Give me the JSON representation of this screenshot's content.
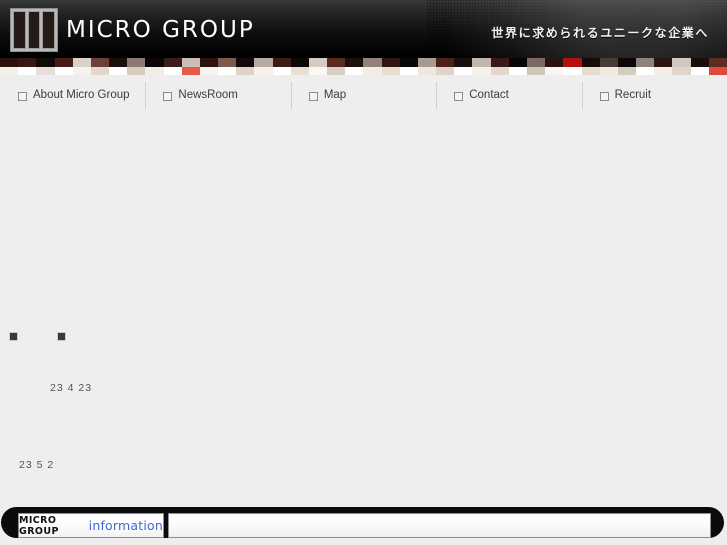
{
  "header": {
    "brand": "MICRO GROUP",
    "tagline": "世界に求められるユニークな企業へ",
    "logo_icon": "three-bars-logo-icon",
    "map_icon": "world-map-icon"
  },
  "banner": {
    "alt": "pixelated-image-strip",
    "top_cells": [
      "#2d110f",
      "#3a1512",
      "#120a09",
      "#4a1a15",
      "#d9d2cb",
      "#6b4038",
      "#1a0e0c",
      "#8c7a70",
      "#0a0606",
      "#3a1d18",
      "#c9bfb6",
      "#2b1310",
      "#7d5a4e",
      "#110a08",
      "#b7aaa0",
      "#401a15",
      "#0d0707",
      "#d3ccc4",
      "#5a2a22",
      "#1c0f0d",
      "#93827a",
      "#2f1411",
      "#0b0606",
      "#a89a90",
      "#4d1f19",
      "#161010",
      "#c2b7ae",
      "#381914",
      "#090505",
      "#7a6a62",
      "#2a1210",
      "#b30f0f",
      "#150c0a",
      "#463b36",
      "#0c0707",
      "#8e8279",
      "#2e1512",
      "#d0c8c0",
      "#1b0e0c",
      "#5e2b23"
    ],
    "bottom_cells": [
      "#f4efe9",
      "#ffffff",
      "#e8dfd6",
      "#ffffff",
      "#f7f2ec",
      "#e3d6ca",
      "#ffffff",
      "#d8ccc0",
      "#f2ece5",
      "#ffffff",
      "#e55b4b",
      "#f8f4ef",
      "#ffffff",
      "#ded3c7",
      "#f6f1eb",
      "#ffffff",
      "#eadfd2",
      "#fbf8f4",
      "#d9cec2",
      "#ffffff",
      "#f3ece4",
      "#e7dcd0",
      "#ffffff",
      "#efe7de",
      "#dfd4c8",
      "#ffffff",
      "#f5f0ea",
      "#e2d7cb",
      "#ffffff",
      "#cfc4b8",
      "#f9f5f0",
      "#ffffff",
      "#e6dbcf",
      "#f1eae2",
      "#d6cbbf",
      "#ffffff",
      "#f4eee7",
      "#e0d5c9",
      "#ffffff",
      "#dc4b3c"
    ]
  },
  "nav": {
    "items": [
      {
        "label": "About Micro Group",
        "bullet_icon": "square-bullet-icon"
      },
      {
        "label": "NewsRoom",
        "bullet_icon": "square-bullet-icon"
      },
      {
        "label": "Map",
        "bullet_icon": "square-bullet-icon"
      },
      {
        "label": "Contact",
        "bullet_icon": "square-bullet-icon"
      },
      {
        "label": "Recruit",
        "bullet_icon": "square-bullet-icon"
      }
    ]
  },
  "main": {
    "markers": [
      {
        "name": "broken-image-marker-1"
      },
      {
        "name": "broken-image-marker-2"
      }
    ],
    "texts": [
      {
        "value": "23 4 23"
      },
      {
        "value": "23 5 2"
      }
    ]
  },
  "footer": {
    "info_tab": {
      "brand": "MICRO GROUP",
      "word": "information"
    },
    "panel_text": ""
  },
  "colors": {
    "page_background": "#eeeeee",
    "header_background": "#0d0d0d",
    "accent_blue": "#4169cd",
    "text_dark": "#3c3c3c",
    "marker_dark": "#3a3a3a"
  }
}
